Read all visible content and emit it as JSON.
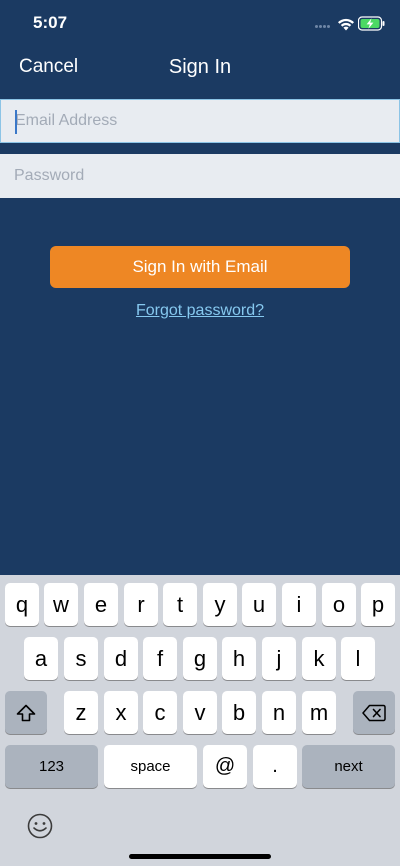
{
  "status_bar": {
    "time": "5:07"
  },
  "nav": {
    "cancel_label": "Cancel",
    "title": "Sign In"
  },
  "form": {
    "email_placeholder": "Email Address",
    "email_value": "",
    "password_placeholder": "Password",
    "password_value": "",
    "signin_label": "Sign In with Email",
    "forgot_label": "Forgot password?"
  },
  "colors": {
    "background": "#1b3a62",
    "accent": "#ee8724",
    "link": "#86c8ef",
    "field_bg": "#e8ecf1",
    "keyboard_bg": "#d1d5dc"
  },
  "keyboard": {
    "row1": [
      "q",
      "w",
      "e",
      "r",
      "t",
      "y",
      "u",
      "i",
      "o",
      "p"
    ],
    "row2": [
      "a",
      "s",
      "d",
      "f",
      "g",
      "h",
      "j",
      "k",
      "l"
    ],
    "row3": [
      "z",
      "x",
      "c",
      "v",
      "b",
      "n",
      "m"
    ],
    "numbers_label": "123",
    "space_label": "space",
    "at_label": "@",
    "dot_label": ".",
    "next_label": "next",
    "shift_icon": "shift-icon",
    "delete_icon": "delete-icon",
    "emoji_icon": "emoji-icon"
  }
}
